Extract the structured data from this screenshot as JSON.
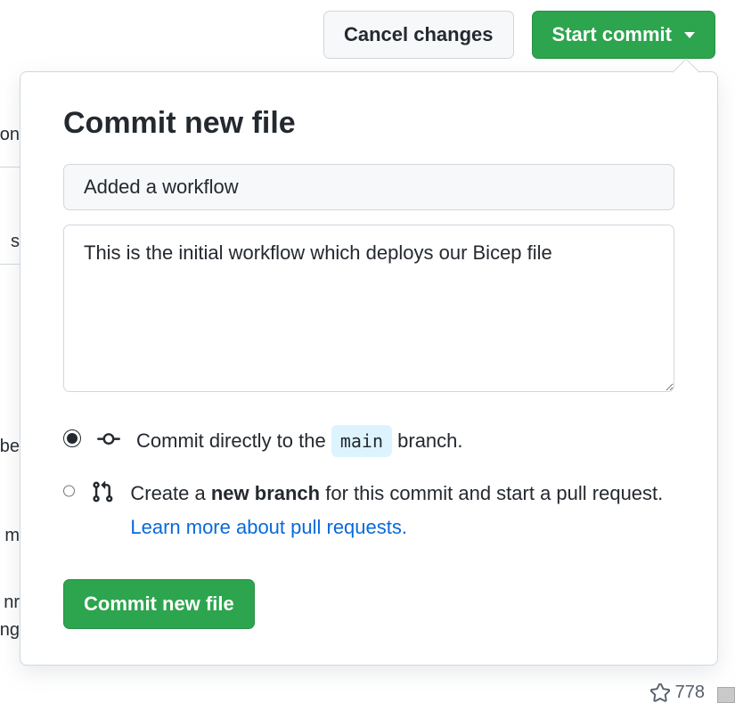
{
  "toolbar": {
    "cancel_label": "Cancel changes",
    "start_commit_label": "Start commit"
  },
  "popover": {
    "title": "Commit new file",
    "summary_value": "Added a workflow",
    "description_value": "This is the initial workflow which deploys our Bicep file",
    "options": {
      "direct": {
        "prefix": "Commit directly to the ",
        "branch": "main",
        "suffix": " branch."
      },
      "new_branch": {
        "prefix": "Create a ",
        "bold": "new branch",
        "middle": " for this commit and start a pull request. ",
        "link": "Learn more about pull requests."
      }
    },
    "submit_label": "Commit new file"
  },
  "fragments": {
    "f1": "on",
    "f2": "s",
    "f3": "be",
    "f4": "m",
    "f5": "nr",
    "f6": "ng"
  },
  "footer": {
    "star_count": "778"
  }
}
